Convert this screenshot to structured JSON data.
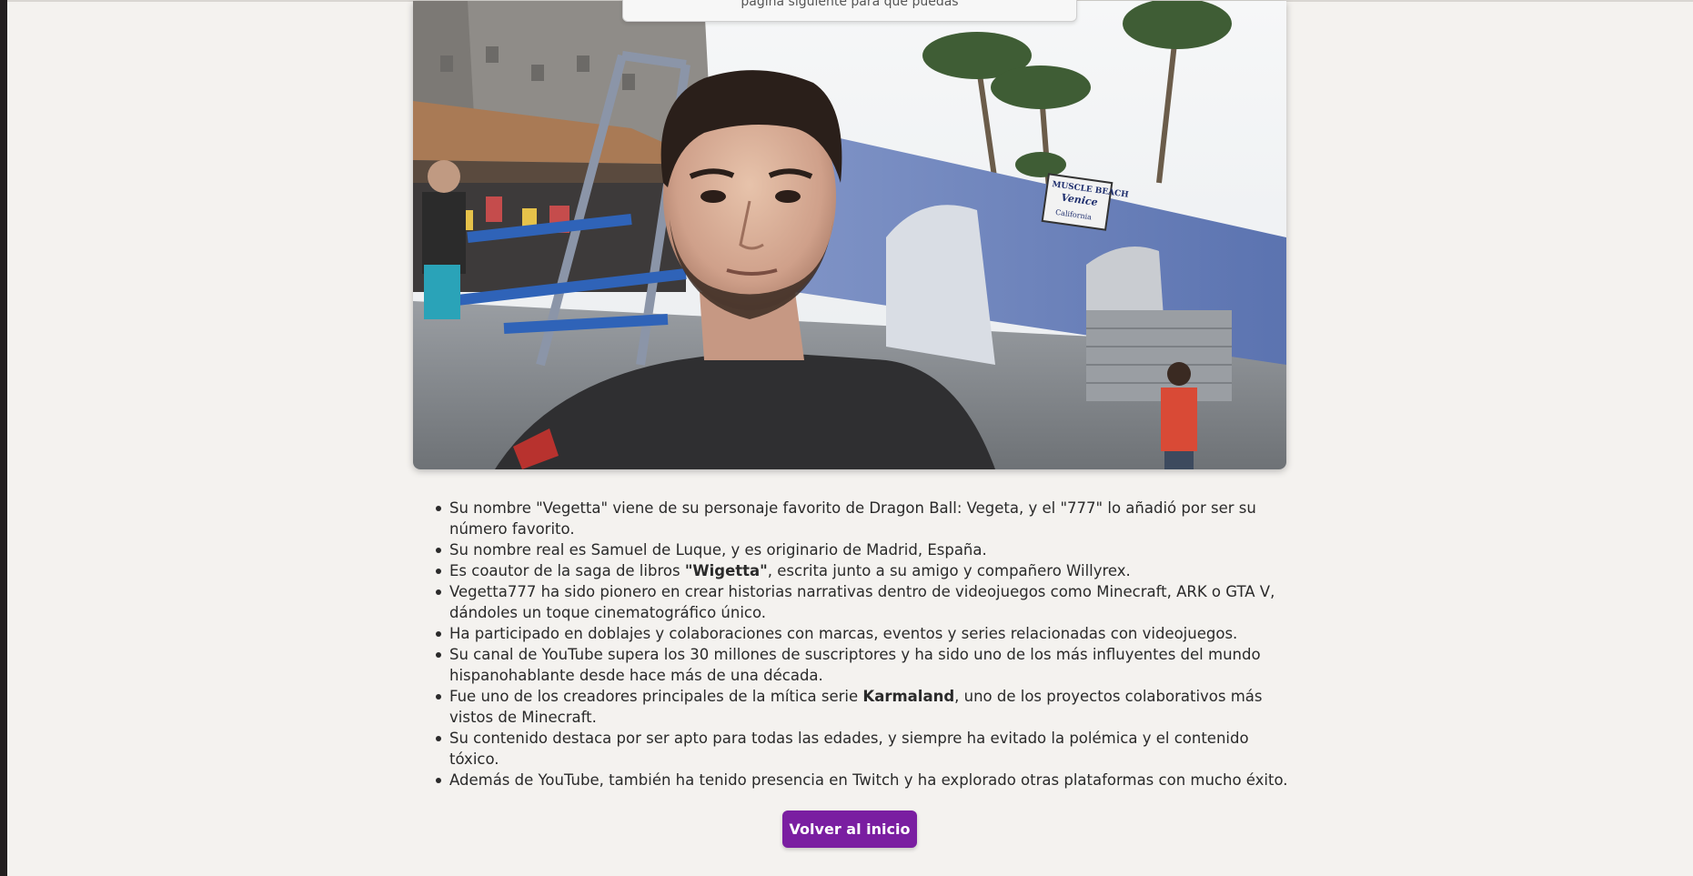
{
  "popup": {
    "text": "página siguiente para que puedas"
  },
  "photo": {
    "sign_line1": "MUSCLE BEACH",
    "sign_line2": "Venice",
    "sign_line3": "California"
  },
  "facts": [
    {
      "pre": "Su nombre \"Vegetta\" viene de su personaje favorito de Dragon Ball: Vegeta, y el \"777\" lo añadió por ser su número favorito.",
      "bold": "",
      "post": ""
    },
    {
      "pre": "Su nombre real es Samuel de Luque, y es originario de Madrid, España.",
      "bold": "",
      "post": ""
    },
    {
      "pre": "Es coautor de la saga de libros ",
      "bold": "\"Wigetta\"",
      "post": ", escrita junto a su amigo y compañero Willyrex."
    },
    {
      "pre": "Vegetta777 ha sido pionero en crear historias narrativas dentro de videojuegos como Minecraft, ARK o GTA V, dándoles un toque cinematográfico único.",
      "bold": "",
      "post": ""
    },
    {
      "pre": "Ha participado en doblajes y colaboraciones con marcas, eventos y series relacionadas con videojuegos.",
      "bold": "",
      "post": ""
    },
    {
      "pre": "Su canal de YouTube supera los 30 millones de suscriptores y ha sido uno de los más influyentes del mundo hispanohablante desde hace más de una década.",
      "bold": "",
      "post": ""
    },
    {
      "pre": "Fue uno de los creadores principales de la mítica serie ",
      "bold": "Karmaland",
      "post": ", uno de los proyectos colaborativos más vistos de Minecraft."
    },
    {
      "pre": "Su contenido destaca por ser apto para todas las edades, y siempre ha evitado la polémica y el contenido tóxico.",
      "bold": "",
      "post": ""
    },
    {
      "pre": "Además de YouTube, también ha tenido presencia en Twitch y ha explorado otras plataformas con mucho éxito.",
      "bold": "",
      "post": ""
    }
  ],
  "button": {
    "label": "Volver al inicio"
  },
  "colors": {
    "background": "#f4f2ef",
    "button": "#7a1ea1",
    "button_text": "#ffffff"
  }
}
